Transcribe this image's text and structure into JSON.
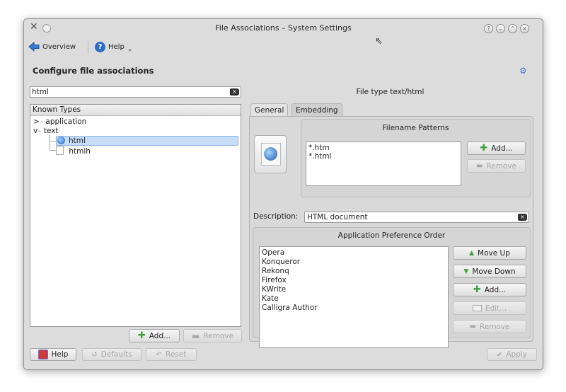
{
  "window": {
    "title": "File Associations – System Settings"
  },
  "toolbar": {
    "overview_label": "Overview",
    "help_label": "Help"
  },
  "heading": "Configure file associations",
  "search": {
    "value": "html"
  },
  "tree": {
    "header": "Known Types",
    "items": [
      {
        "label": "application",
        "expander": ">"
      },
      {
        "label": "text",
        "expander": "v"
      },
      {
        "label": "html",
        "selected": true
      },
      {
        "label": "htmlh"
      }
    ],
    "add_label": "Add...",
    "remove_label": "Remove"
  },
  "filetype": {
    "title": "File type text/html"
  },
  "tabs": [
    {
      "label": "General",
      "active": true
    },
    {
      "label": "Embedding",
      "active": false
    }
  ],
  "patterns": {
    "title": "Filename Patterns",
    "items": [
      "*.htm",
      "*.html"
    ],
    "add_label": "Add...",
    "remove_label": "Remove"
  },
  "description": {
    "label": "Description:",
    "value": "HTML document"
  },
  "apps": {
    "title": "Application Preference Order",
    "items": [
      "Opera",
      "Konqueror",
      "Rekonq",
      "Firefox",
      "KWrite",
      "Kate",
      "Calligra Author"
    ],
    "move_up_label": "Move Up",
    "move_down_label": "Move Down",
    "add_label": "Add...",
    "edit_label": "Edit...",
    "remove_label": "Remove"
  },
  "bottom": {
    "help_label": "Help",
    "defaults_label": "Defaults",
    "reset_label": "Reset",
    "apply_label": "Apply"
  },
  "colors": {
    "selection": "#c5ddf6",
    "add_icon": "#3fa33b",
    "window_bg": "#dcdcdc"
  }
}
